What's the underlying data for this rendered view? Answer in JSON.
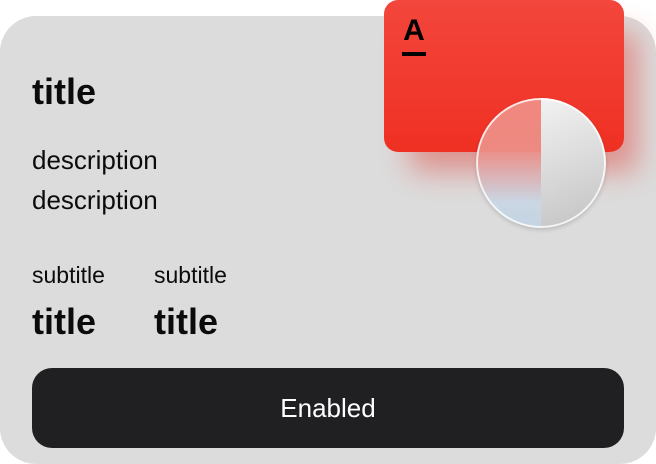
{
  "card": {
    "title": "title",
    "description_lines": [
      "description",
      "description"
    ],
    "metrics": [
      {
        "subtitle": "subtitle",
        "value": "title"
      },
      {
        "subtitle": "subtitle",
        "value": "title"
      }
    ],
    "button_label": "Enabled"
  },
  "bank_card": {
    "logo_letter": "A",
    "icon": "bank-card-icon",
    "color": "#ef3023"
  },
  "toggle": {
    "icon": "half-toggle-disk-icon"
  },
  "colors": {
    "card_background": "#dcdcdc",
    "button_background": "#202023",
    "button_text": "#ffffff",
    "text": "#0b0b0c"
  }
}
